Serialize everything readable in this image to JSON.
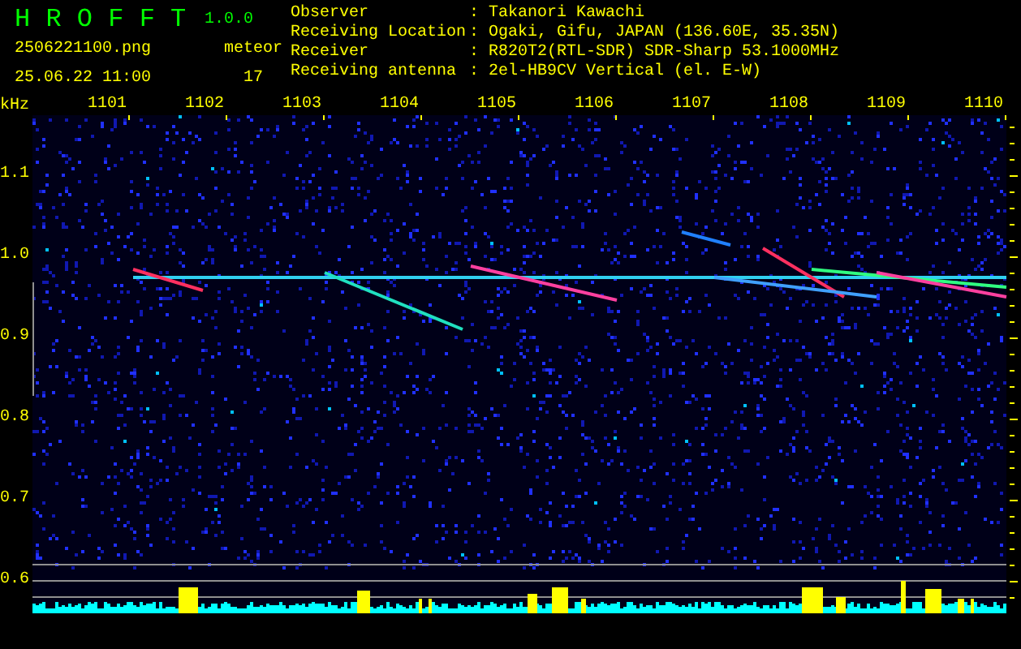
{
  "app": {
    "title": "H R O F F T",
    "version": "1.0.0"
  },
  "file_name": "2506221100.png",
  "datetime": "25.06.22 11:00",
  "meteor": {
    "label": "meteor",
    "count": "17"
  },
  "info": [
    {
      "label": "Observer",
      "separator": ":",
      "value": "Takanori Kawachi"
    },
    {
      "label": "Receiving Location",
      "separator": ":",
      "value": "Ogaki, Gifu, JAPAN (136.60E, 35.35N)"
    },
    {
      "label": "Receiver",
      "separator": ":",
      "value": "R820T2(RTL-SDR) SDR-Sharp 53.1000MHz"
    },
    {
      "label": "Receiving antenna",
      "separator": ":",
      "value": "2el-HB9CV Vertical (el. E-W)"
    }
  ],
  "axis": {
    "unit": "kHz",
    "x_ticks": [
      "1101",
      "1102",
      "1103",
      "1104",
      "1105",
      "1106",
      "1107",
      "1108",
      "1109",
      "1110"
    ],
    "y_ticks": [
      "1.1",
      "1.0",
      "0.9",
      "0.8",
      "0.7",
      "0.6"
    ]
  }
}
